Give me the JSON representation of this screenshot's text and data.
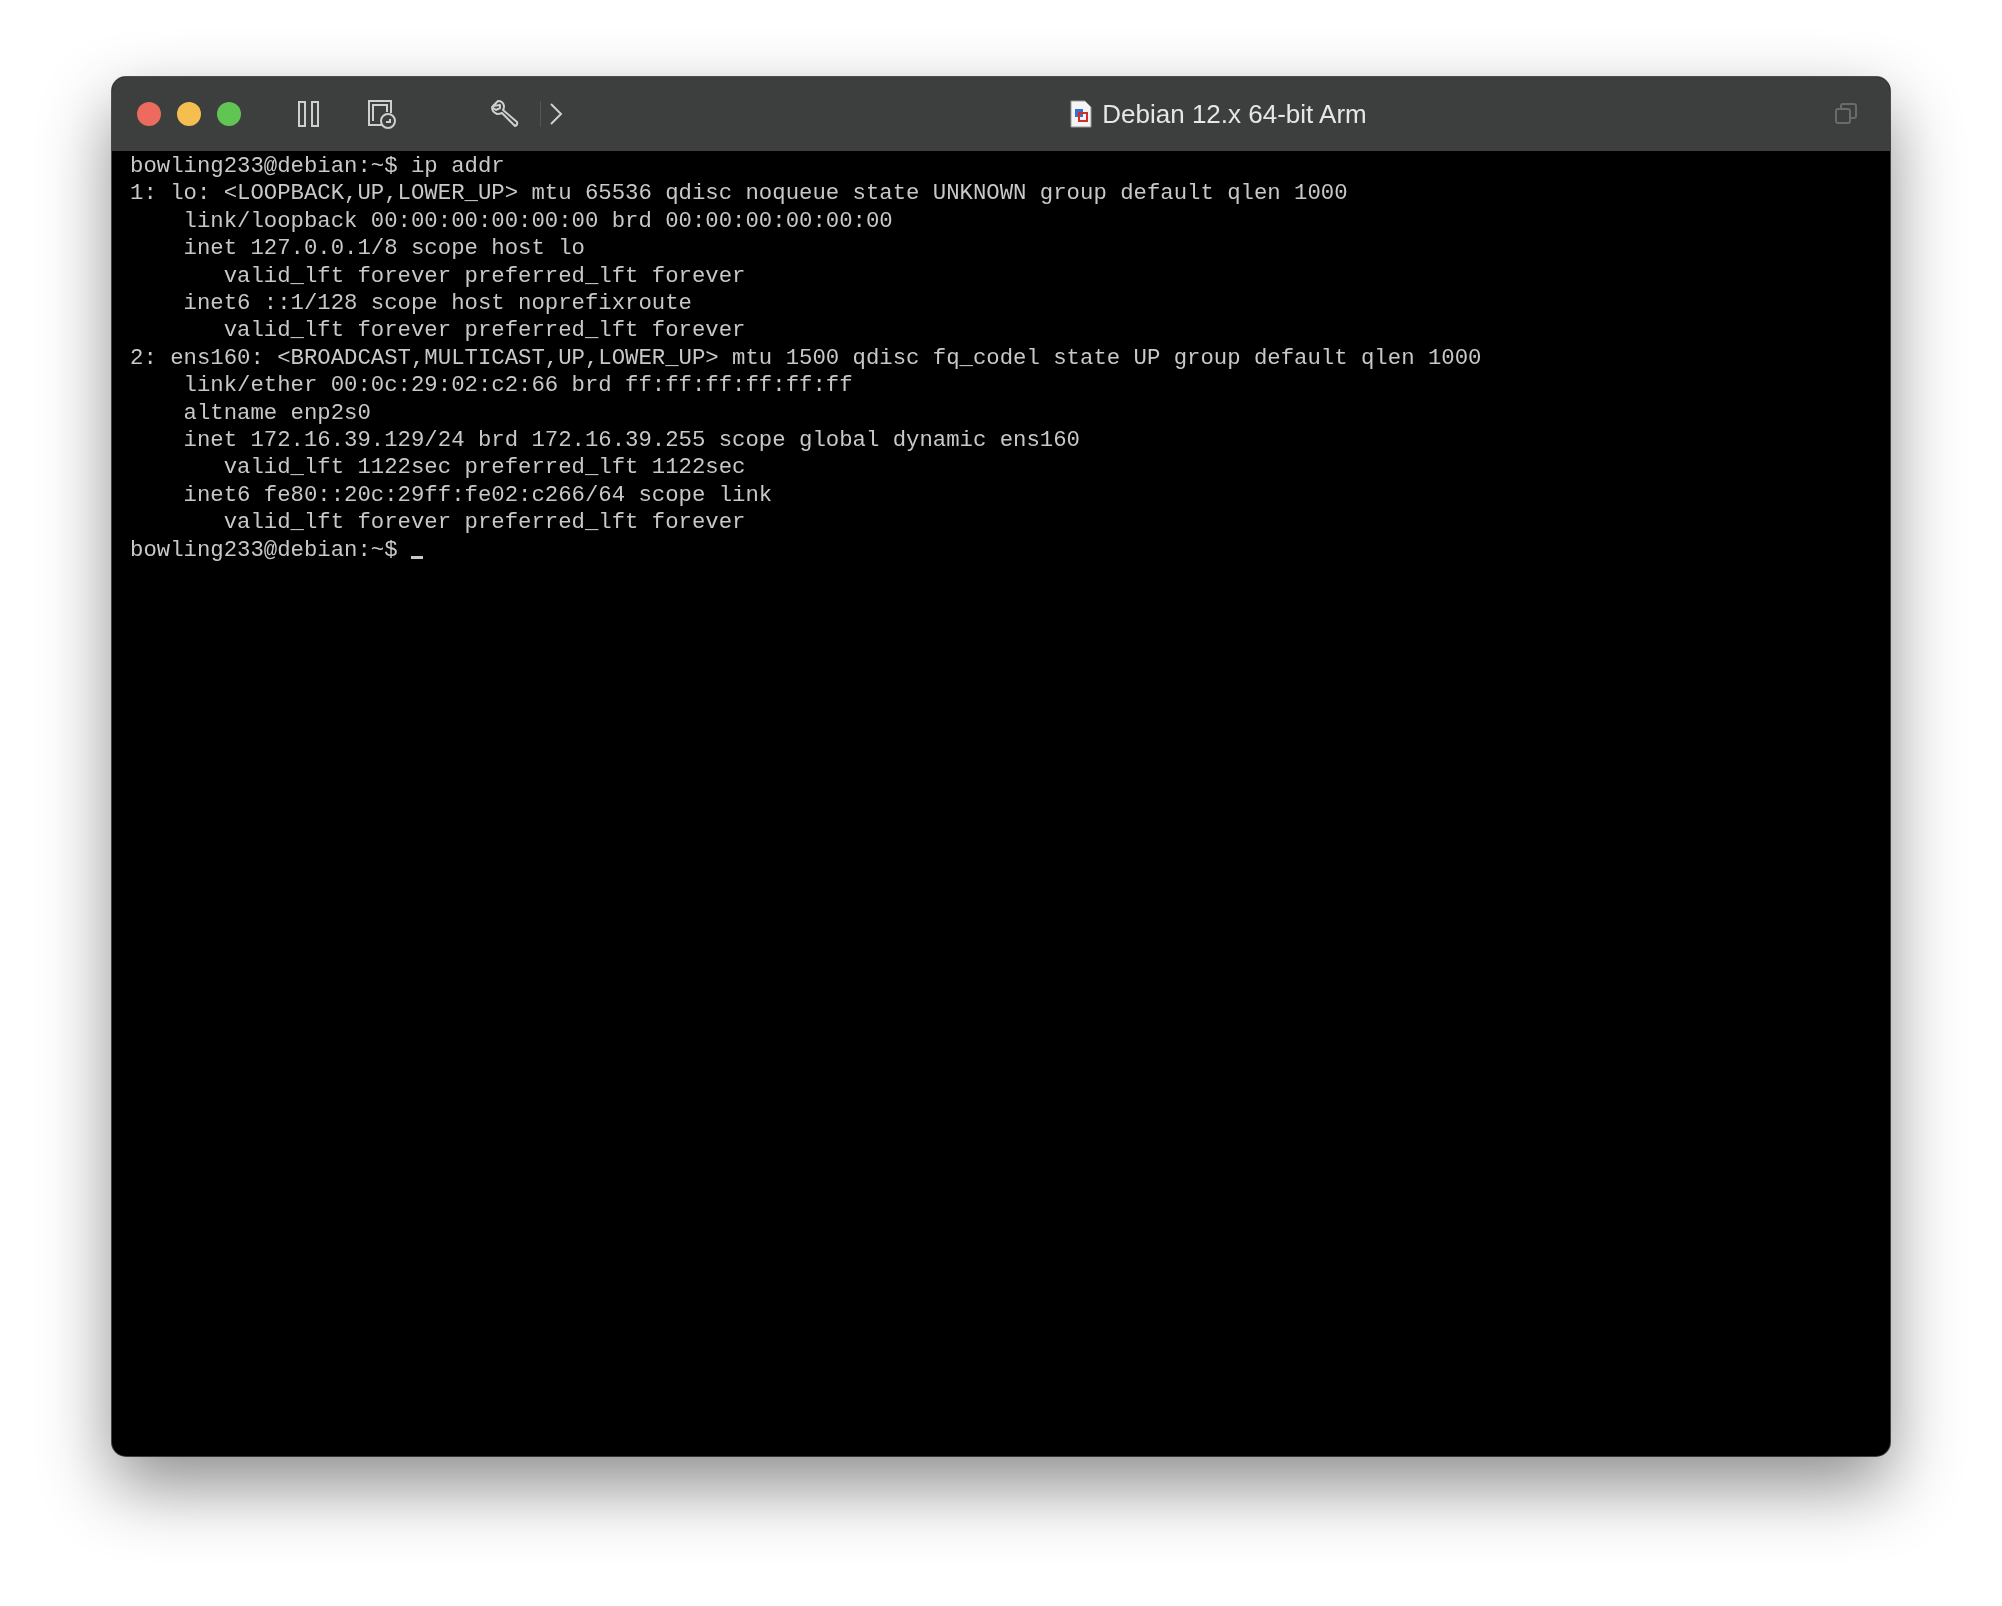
{
  "window": {
    "title": "Debian 12.x 64-bit Arm"
  },
  "terminal": {
    "lines": [
      "bowling233@debian:~$ ip addr",
      "1: lo: <LOOPBACK,UP,LOWER_UP> mtu 65536 qdisc noqueue state UNKNOWN group default qlen 1000",
      "    link/loopback 00:00:00:00:00:00 brd 00:00:00:00:00:00",
      "    inet 127.0.0.1/8 scope host lo",
      "       valid_lft forever preferred_lft forever",
      "    inet6 ::1/128 scope host noprefixroute",
      "       valid_lft forever preferred_lft forever",
      "2: ens160: <BROADCAST,MULTICAST,UP,LOWER_UP> mtu 1500 qdisc fq_codel state UP group default qlen 1000",
      "    link/ether 00:0c:29:02:c2:66 brd ff:ff:ff:ff:ff:ff",
      "    altname enp2s0",
      "    inet 172.16.39.129/24 brd 172.16.39.255 scope global dynamic ens160",
      "       valid_lft 1122sec preferred_lft 1122sec",
      "    inet6 fe80::20c:29ff:fe02:c266/64 scope link",
      "       valid_lft forever preferred_lft forever"
    ],
    "prompt": "bowling233@debian:~$ "
  }
}
